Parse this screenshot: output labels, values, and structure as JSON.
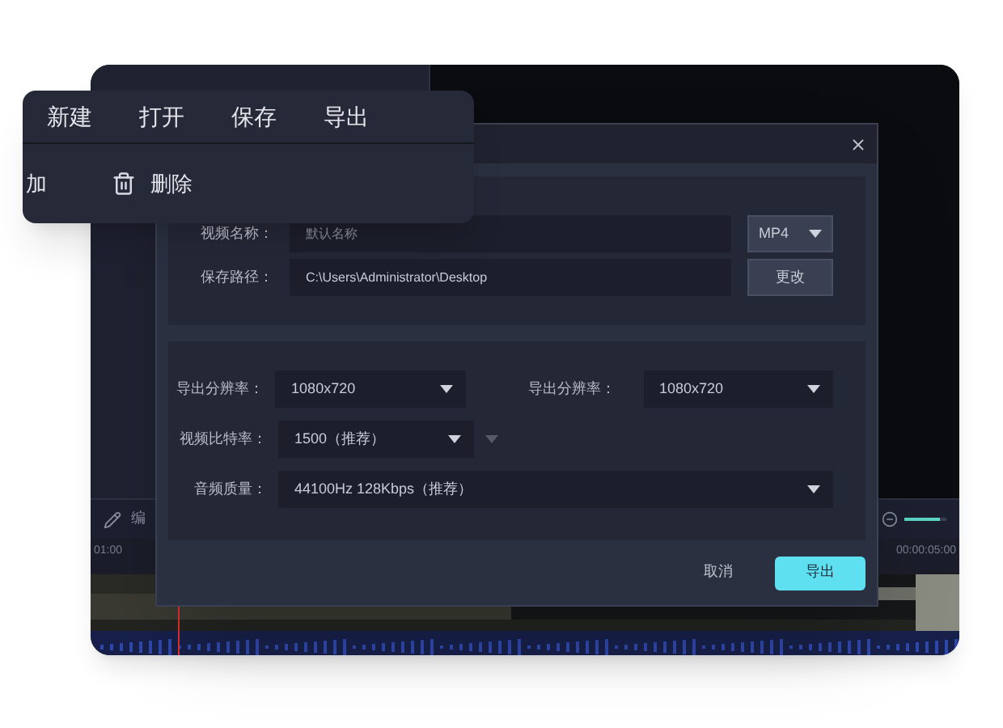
{
  "menu": {
    "items": [
      {
        "label": "新建"
      },
      {
        "label": "打开"
      },
      {
        "label": "保存"
      },
      {
        "label": "导出"
      }
    ],
    "actions": [
      {
        "kind": "text",
        "label": "加"
      },
      {
        "kind": "delete",
        "label": "删除"
      }
    ]
  },
  "dialog": {
    "name": {
      "label": "视频名称：",
      "placeholder": "默认名称",
      "format": "MP4"
    },
    "path": {
      "label": "保存路径：",
      "value": "C:\\Users\\Administrator\\Desktop",
      "button": "更改"
    },
    "settings": [
      {
        "label": "导出分辨率：",
        "value": "1080x720"
      },
      {
        "label": "导出分辨率：",
        "value": "1080x720"
      },
      {
        "label": "视频比特率：",
        "value": "1500（推荐）"
      },
      {
        "label": "音频质量：",
        "value": "44100Hz 128Kbps（推荐）"
      }
    ],
    "buttons": [
      {
        "label": "取消",
        "primary": false
      },
      {
        "label": "导出",
        "primary": true
      }
    ]
  },
  "timeline": {
    "tool": "编",
    "times": [
      "01:00",
      "00:00:05:00"
    ],
    "zoom": {
      "level": 0.85
    }
  }
}
